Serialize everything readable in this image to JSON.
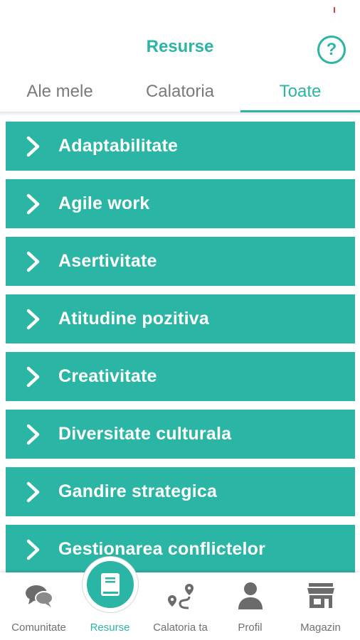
{
  "header": {
    "title": "Resurse",
    "help_icon": "question-circle-icon",
    "help_glyph": "?"
  },
  "tabs": [
    {
      "label": "Ale mele",
      "active": false
    },
    {
      "label": "Calatoria",
      "active": false
    },
    {
      "label": "Toate",
      "active": true
    }
  ],
  "resources": [
    {
      "label": "Adaptabilitate"
    },
    {
      "label": "Agile work"
    },
    {
      "label": "Asertivitate"
    },
    {
      "label": "Atitudine pozitiva"
    },
    {
      "label": "Creativitate"
    },
    {
      "label": "Diversitate culturala"
    },
    {
      "label": "Gandire strategica"
    },
    {
      "label": "Gestionarea conflictelor"
    }
  ],
  "bottom_nav": [
    {
      "label": "Comunitate",
      "icon": "chat-bubbles-icon",
      "active": false
    },
    {
      "label": "Resurse",
      "icon": "book-icon",
      "active": true
    },
    {
      "label": "Calatoria ta",
      "icon": "route-icon",
      "active": false
    },
    {
      "label": "Profil",
      "icon": "person-icon",
      "active": false
    },
    {
      "label": "Magazin",
      "icon": "store-icon",
      "active": false
    }
  ],
  "colors": {
    "accent": "#2bb5a4",
    "inactive": "#707070",
    "icon_gray": "#6b6b6b"
  }
}
